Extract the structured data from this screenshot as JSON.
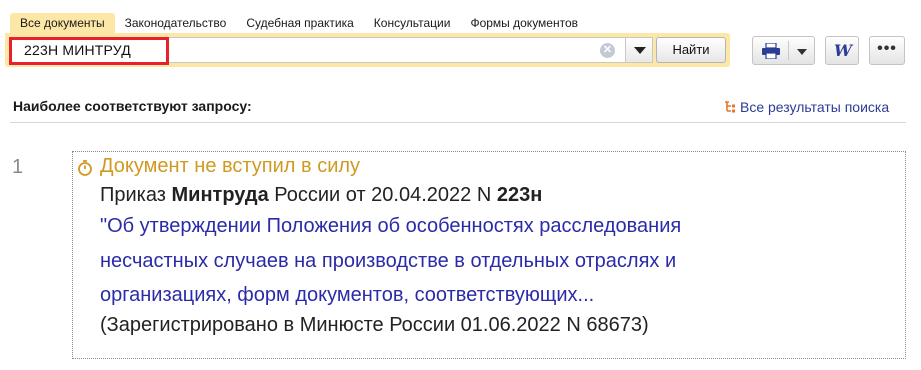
{
  "tabs": [
    "Все документы",
    "Законодательство",
    "Судебная практика",
    "Консультации",
    "Формы документов"
  ],
  "search": {
    "query": "223Н МИНТРУД",
    "find_label": "Найти"
  },
  "results_header": {
    "title": "Наиболее соответствуют запросу:",
    "all_results_link": "Все результаты поиска"
  },
  "result": {
    "number": "1",
    "status": "Документ не вступил в силу",
    "doc_prefix": "Приказ ",
    "doc_bold1": "Минтруда",
    "doc_mid": " России от 20.04.2022 N ",
    "doc_bold2": "223н",
    "title_lines": [
      "\"Об утверждении Положения об особенностях расследования",
      "несчастных случаев на производстве в отдельных отраслях и",
      "организациях, форм документов, соответствующих..."
    ],
    "registration": "(Зарегистрировано в Минюсте России 01.06.2022 N 68673)"
  },
  "icons": {
    "clear": "clear-icon",
    "dropdown": "chevron-down-icon",
    "print": "printer-icon",
    "word": "word-export-icon",
    "more": "more-icon",
    "tree": "tree-list-icon",
    "status": "clock-icon"
  },
  "colors": {
    "tab_active": "#fde7a6",
    "highlight_border": "#e8202a",
    "status": "#d09a21",
    "link": "#2b2ba8"
  }
}
